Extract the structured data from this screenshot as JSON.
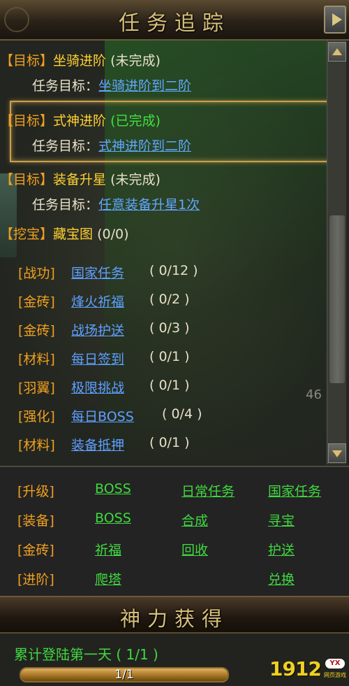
{
  "header": {
    "title": "任务追踪"
  },
  "quests": [
    {
      "tag": "【目标】",
      "name": "坐骑进阶",
      "status": "(未完成)",
      "done": false,
      "goal_label": "任务目标：",
      "goal_link": "坐骑进阶到二阶"
    },
    {
      "tag": "【目标】",
      "name": "式神进阶",
      "status": "(已完成)",
      "done": true,
      "goal_label": "任务目标：",
      "goal_link": "式神进阶到二阶"
    },
    {
      "tag": "【目标】",
      "name": "装备升星",
      "status": "(未完成)",
      "done": false,
      "goal_label": "任务目标：",
      "goal_link": "任意装备升星1次"
    },
    {
      "tag": "【挖宝】",
      "name": "藏宝图",
      "status": "(0/0)",
      "done": false
    }
  ],
  "dailies": [
    {
      "cat": "[战功]",
      "name": "国家任务",
      "count": "( 0/12 )"
    },
    {
      "cat": "[金砖]",
      "name": "烽火祈福",
      "count": "( 0/2 )"
    },
    {
      "cat": "[金砖]",
      "name": "战场护送",
      "count": "( 0/3 )"
    },
    {
      "cat": "[材料]",
      "name": "每日签到",
      "count": "( 0/1 )"
    },
    {
      "cat": "[羽翼]",
      "name": "极限挑战",
      "count": "( 0/1 )"
    },
    {
      "cat": "[强化]",
      "name": "每日BOSS",
      "count": "( 0/4 )"
    },
    {
      "cat": "[材料]",
      "name": "装备抵押",
      "count": "( 0/1 )"
    }
  ],
  "faded_number": "46",
  "shortcuts": [
    {
      "cat": "[升级]",
      "links": [
        "BOSS",
        "日常任务",
        "国家任务"
      ]
    },
    {
      "cat": "[装备]",
      "links": [
        "BOSS",
        "合成",
        "寻宝"
      ]
    },
    {
      "cat": "[金砖]",
      "links": [
        "祈福",
        "回收",
        "护送"
      ]
    },
    {
      "cat": "[进阶]",
      "links": [
        "爬塔",
        "",
        "兑换"
      ]
    }
  ],
  "power": {
    "title": "神力获得",
    "task": "累计登陆第一天 ( 1/1 )",
    "progress_text": "1/1",
    "progress": 1.0
  },
  "logo": {
    "num": "1912",
    "badge": "YX",
    "sub": "网页游戏"
  }
}
